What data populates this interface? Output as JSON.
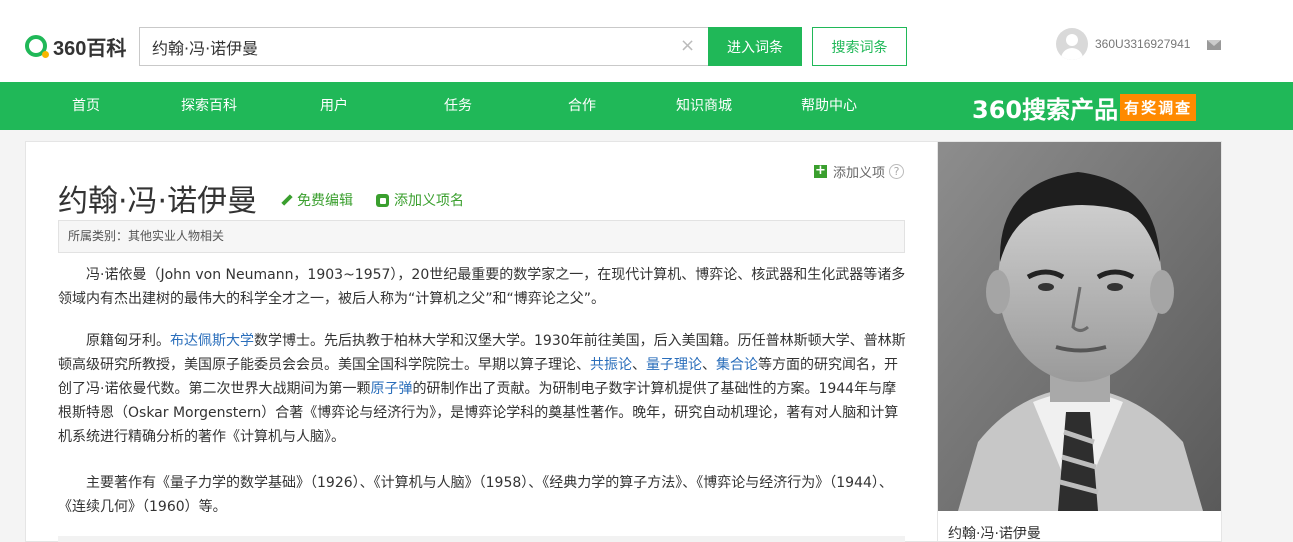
{
  "header": {
    "logo_text": "360百科",
    "search_value": "约翰·冯·诺伊曼",
    "enter_button": "进入词条",
    "search_button": "搜索词条",
    "username": "360U3316927941"
  },
  "nav": {
    "items": [
      "首页",
      "探索百科",
      "用户",
      "任务",
      "合作",
      "知识商城",
      "帮助中心"
    ],
    "promo_text": "360搜索产品",
    "promo_badge": "有奖调查"
  },
  "article": {
    "title": "约翰·冯·诺伊曼",
    "edit_link": "免费编辑",
    "add_name_link": "添加义项名",
    "add_meaning": "添加义项",
    "help": "?",
    "category": "所属类别：其他实业人物相关",
    "p1": "冯·诺依曼（John von Neumann，1903~1957），20世纪最重要的数学家之一，在现代计算机、博弈论、核武器和生化武器等诸多领域内有杰出建树的最伟大的科学全才之一，被后人称为“计算机之父”和“博弈论之父”。",
    "p2": {
      "t1": "原籍匈牙利。",
      "link1": "布达佩斯大学",
      "t2": "数学博士。先后执教于柏林大学和汉堡大学。1930年前往美国，后入美国籍。历任普林斯顿大学、普林斯顿高级研究所教授，美国原子能委员会会员。美国全国科学院院士。早期以算子理论、",
      "link2": "共振论",
      "t3": "、",
      "link3": "量子理论",
      "t4": "、",
      "link4": "集合论",
      "t5": "等方面的研究闻名，开创了冯·诺依曼代数。第二次世界大战期间为第一颗",
      "link5": "原子弹",
      "t6": "的研制作出了贡献。为研制电子数字计算机提供了基础性的方案。1944年与摩根斯特恩（Oskar Morgenstern）合著《博弈论与经济行为》，是博弈论学科的奠基性著作。晚年，研究自动机理论，著有对人脑和计算机系统进行精确分析的著作《计算机与人脑》。"
    },
    "p3": "主要著作有《量子力学的数学基础》（1926）、《计算机与人脑》（1958）、《经典力学的算子方法》、《博弈论与经济行为》（1944）、《连续几何》（1960）等。"
  },
  "sidebar": {
    "caption": "约翰·冯·诺伊曼"
  }
}
